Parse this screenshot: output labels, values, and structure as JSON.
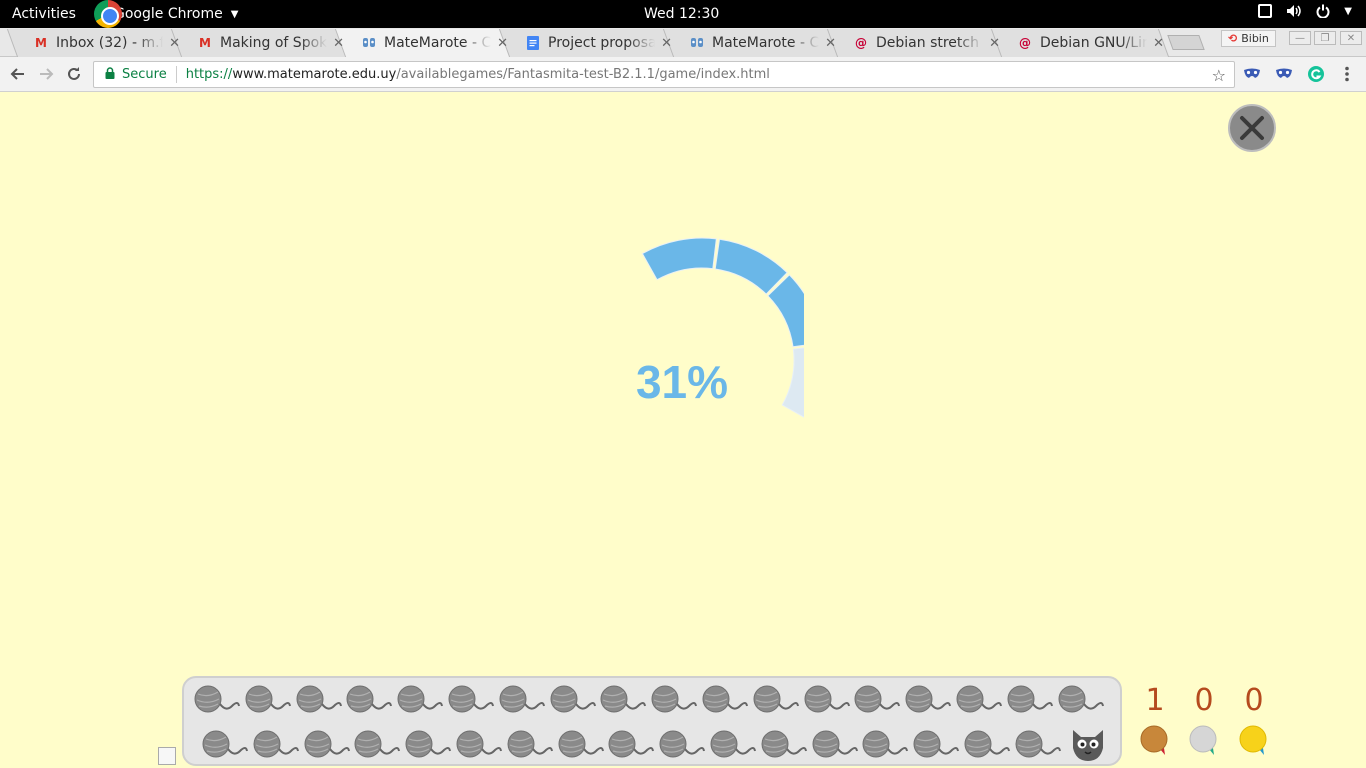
{
  "topbar": {
    "activities": "Activities",
    "app_name": "Google Chrome",
    "clock": "Wed 12:30"
  },
  "tabs": [
    {
      "label": "Inbox (32) - m.f",
      "favicon": "gmail-icon",
      "active": false
    },
    {
      "label": "Making of Spok",
      "favicon": "gmail-icon",
      "active": false
    },
    {
      "label": "MateMarote - C",
      "favicon": "matemarote-icon",
      "active": true
    },
    {
      "label": "Project proposa",
      "favicon": "docs-icon",
      "active": false
    },
    {
      "label": "MateMarote - C",
      "favicon": "matemarote-icon",
      "active": false
    },
    {
      "label": "Debian stretch",
      "favicon": "debian-icon",
      "active": false
    },
    {
      "label": "Debian GNU/Lin",
      "favicon": "debian-icon",
      "active": false
    }
  ],
  "profile": {
    "label": "Bibin"
  },
  "toolbar": {
    "secure_label": "Secure",
    "url_scheme": "https://",
    "url_host": "www.matemarote.edu.uy",
    "url_path": "/availablegames/Fantasmita-test-B2.1.1/game/index.html"
  },
  "game": {
    "progress_label": "31%",
    "progress_fraction": 0.31,
    "medals": [
      {
        "count": "1",
        "kind": "bronze",
        "color": "#c8873a"
      },
      {
        "count": "0",
        "kind": "silver",
        "color": "#d6d6d6"
      },
      {
        "count": "0",
        "kind": "gold",
        "color": "#f7d21a"
      }
    ],
    "yarn_row1_count": 18,
    "yarn_row2_count": 17,
    "colors": {
      "background": "#fffdca",
      "progress": "#6ab7e8",
      "progress_track": "#dde9f2"
    }
  }
}
